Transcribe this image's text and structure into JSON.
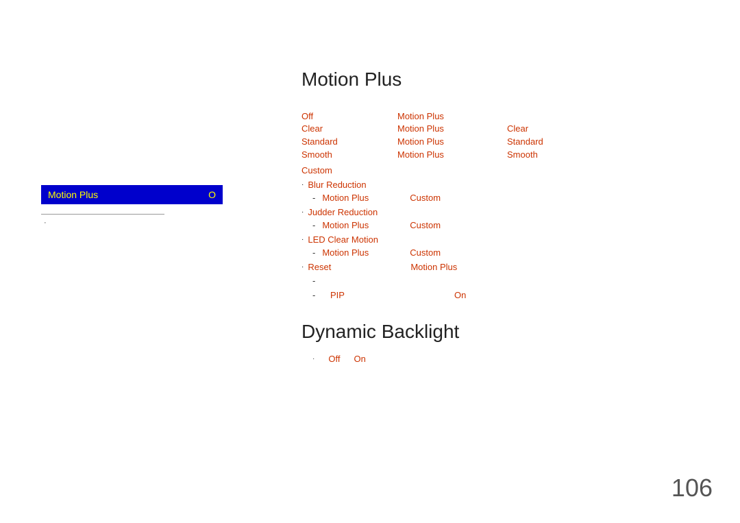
{
  "sidebar": {
    "item_label": "Motion Plus",
    "item_value": "O",
    "sub_text": "·"
  },
  "main": {
    "section1_title": "Motion Plus",
    "section2_title": "Dynamic Backlight",
    "top_row": {
      "col1": "Off",
      "col2": "Motion Plus",
      "col3": "",
      "col4": ""
    },
    "options": [
      {
        "col1": "Clear",
        "col2": "Motion Plus",
        "col3": "Clear",
        "col4": ""
      },
      {
        "col1": "Standard",
        "col2": "Motion Plus",
        "col3": "Standard",
        "col4": ""
      },
      {
        "col1": "Smooth",
        "col2": "Motion Plus",
        "col3": "Smooth",
        "col4": ""
      }
    ],
    "custom_label": "Custom",
    "sub_items": [
      {
        "bullet": "·",
        "name": "Blur Reduction",
        "dash": "-",
        "right1": "Motion Plus",
        "right2": "Custom"
      },
      {
        "bullet": "·",
        "name": "Judder Reduction",
        "dash": "-",
        "right1": "Motion Plus",
        "right2": "Custom"
      },
      {
        "bullet": "·",
        "name": "LED Clear Motion",
        "dash": "-",
        "right1": "Motion Plus",
        "right2": "Custom"
      }
    ],
    "reset": {
      "bullet": "·",
      "name": "Reset",
      "dash": "-",
      "value": "Motion Plus"
    },
    "pip": {
      "dash": "-",
      "label": "PIP",
      "value": "On"
    },
    "backlight": {
      "bullet": "·",
      "option1": "Off",
      "option2": "On"
    }
  },
  "page_number": "106"
}
